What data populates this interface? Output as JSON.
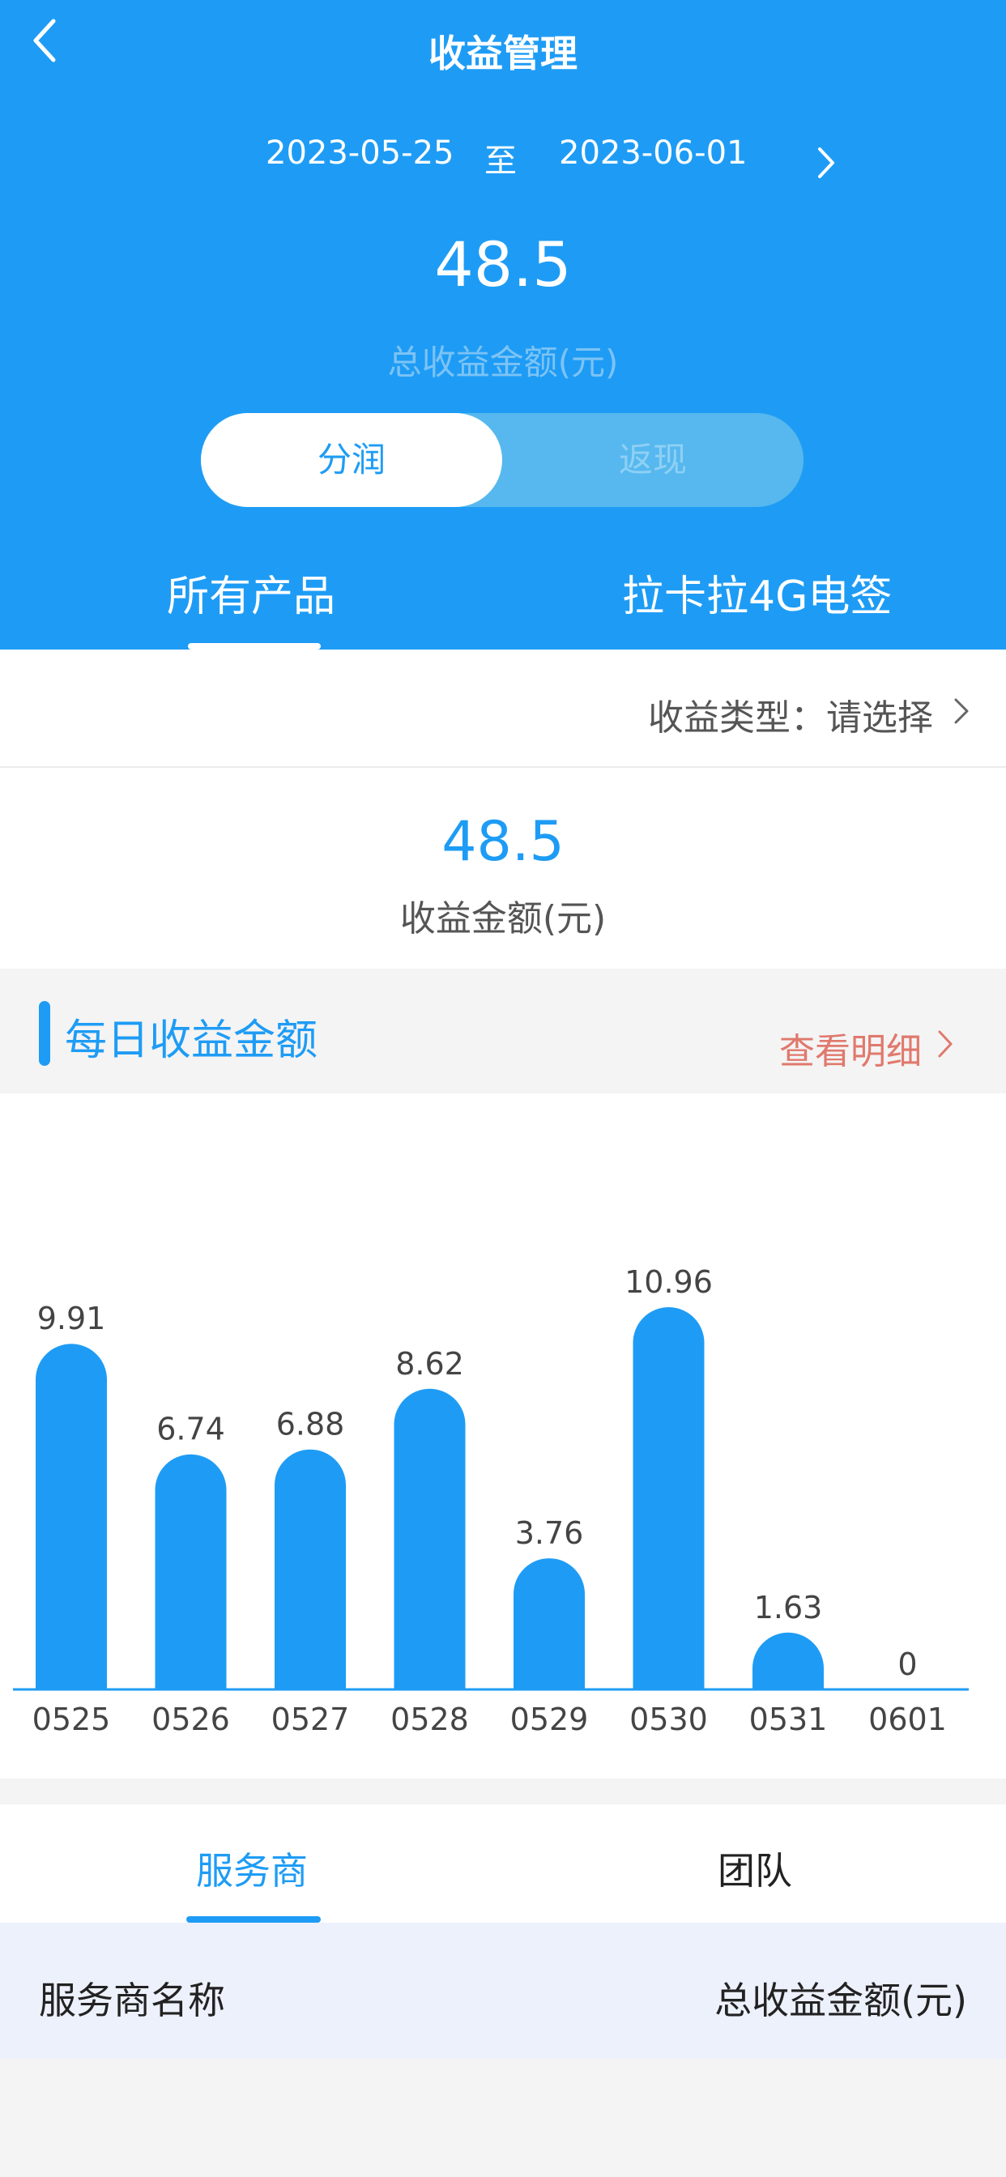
{
  "header": {
    "title": "收益管理",
    "date_start": "2023-05-25",
    "date_separator": "至",
    "date_end": "2023-06-01",
    "total_amount": "48.5",
    "total_label": "总收益金额(元)",
    "toggle": {
      "active": "分润",
      "inactive": "返现"
    },
    "product_tabs": [
      "所有产品",
      "拉卡拉4G电签"
    ],
    "selected_product_tab": 0
  },
  "filter": {
    "income_type_label": "收益类型：请选择"
  },
  "summary": {
    "value": "48.5",
    "label": "收益金额(元)"
  },
  "daily_section": {
    "title": "每日收益金额",
    "detail_link": "查看明细"
  },
  "chart_data": {
    "type": "bar",
    "categories": [
      "0525",
      "0526",
      "0527",
      "0528",
      "0529",
      "0530",
      "0531",
      "0601"
    ],
    "values": [
      9.91,
      6.74,
      6.88,
      8.62,
      3.76,
      10.96,
      1.63,
      0
    ],
    "value_labels": [
      "9.91",
      "6.74",
      "6.88",
      "8.62",
      "3.76",
      "10.96",
      "1.63",
      "0"
    ],
    "title": "",
    "xlabel": "",
    "ylabel": "",
    "grid": false,
    "bar_color": "#1e9cf5"
  },
  "bottom_tabs": {
    "items": [
      "服务商",
      "团队"
    ],
    "selected": 0
  },
  "table": {
    "col_name": "服务商名称",
    "col_amount": "总收益金额(元)"
  },
  "colors": {
    "primary": "#1e9cf5",
    "link": "#e0796d",
    "table_header_bg": "#edf1fb"
  }
}
